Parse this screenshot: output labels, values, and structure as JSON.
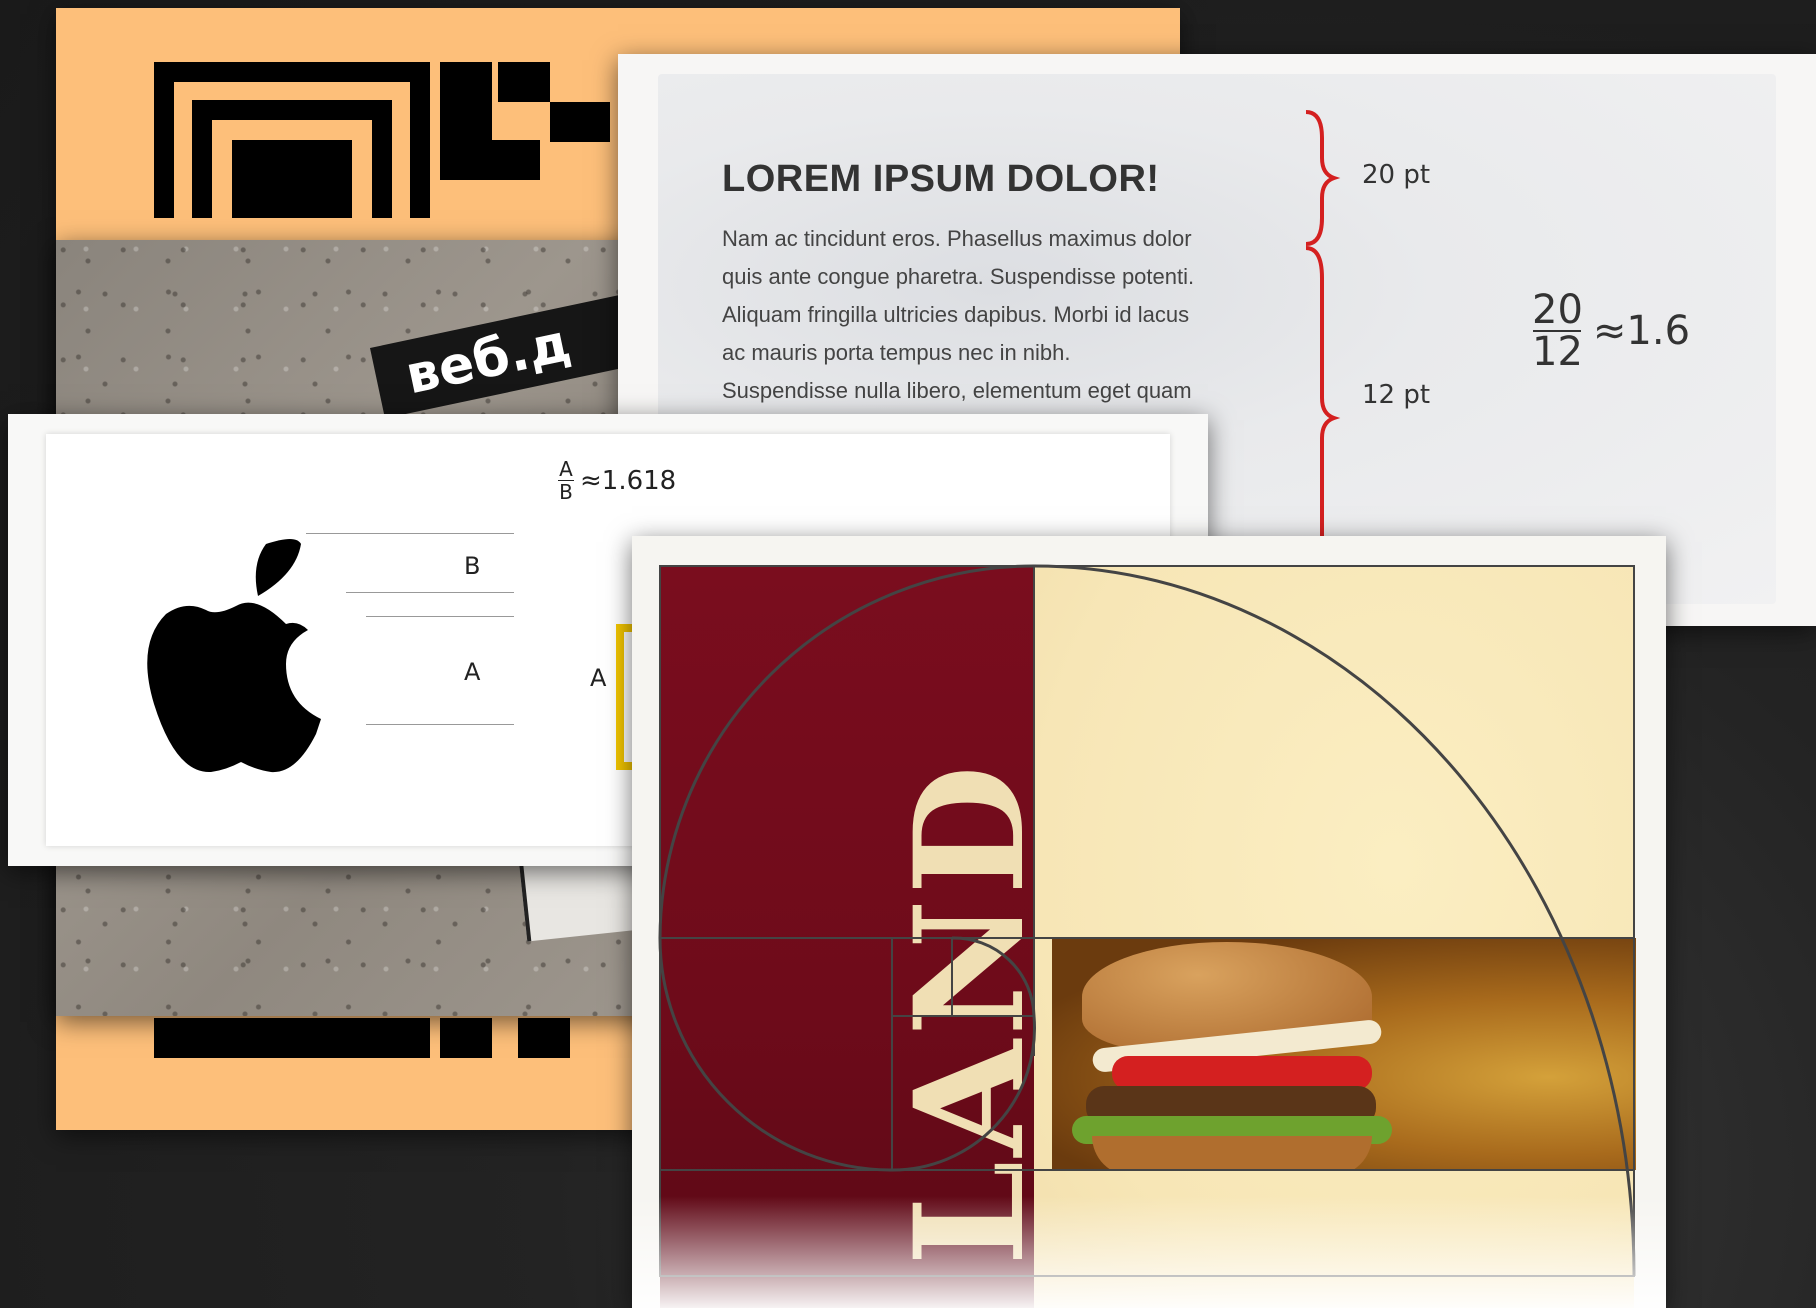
{
  "article": {
    "title": "LOREM IPSUM DOLOR!",
    "lines": [
      "Nam ac tincidunt eros. Phasellus maximus dolor",
      "quis ante congue pharetra. Suspendisse potenti.",
      "Aliquam fringilla ultricies dapibus. Morbi id lacus",
      "ac mauris porta tempus nec in nibh.",
      "Suspendisse nulla libero, elementum eget quam"
    ],
    "heading_size": "20 pt",
    "body_size": "12 pt",
    "ratio_numerator": "20",
    "ratio_denominator": "12",
    "ratio_value": "≈1.6"
  },
  "apple": {
    "ratio_numerator": "A",
    "ratio_denominator": "B",
    "ratio_value": "≈1.618",
    "label_b": "B",
    "label_a": "A",
    "label_a2": "A"
  },
  "photo": {
    "book_text": "веб.д"
  },
  "burger": {
    "vertical_text": "LAND"
  },
  "colors": {
    "qr_orange": "#fdbf7a",
    "maroon": "#7a0d1e",
    "cream": "#f7e6b6",
    "brace_red": "#d42020",
    "accent_yellow": "#f2c500"
  }
}
